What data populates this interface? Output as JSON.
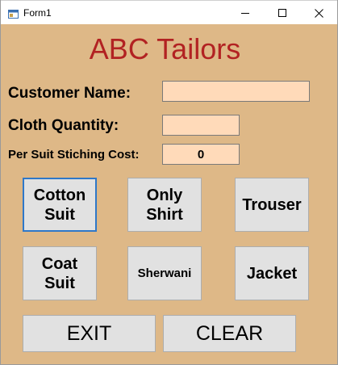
{
  "window": {
    "title": "Form1",
    "icon": "form-icon",
    "controls": {
      "minimize_icon": "minimize-icon",
      "maximize_icon": "maximize-icon",
      "close_icon": "close-icon"
    }
  },
  "form": {
    "heading": "ABC Tailors",
    "customer_name": {
      "label": "Customer Name:",
      "value": ""
    },
    "cloth_quantity": {
      "label": "Cloth Quantity:",
      "value": ""
    },
    "per_suit_cost": {
      "label": "Per Suit Stiching Cost:",
      "value": "0"
    }
  },
  "buttons": {
    "cotton_suit": {
      "line1": "Cotton",
      "line2": "Suit"
    },
    "only_shirt": {
      "line1": "Only",
      "line2": "Shirt"
    },
    "trouser": "Trouser",
    "coat_suit": {
      "line1": "Coat",
      "line2": "Suit"
    },
    "sherwani": "Sherwani",
    "jacket": "Jacket",
    "exit": "EXIT",
    "clear": "CLEAR"
  },
  "colors": {
    "form_background": "#deb887",
    "heading": "#b22222",
    "input_background": "#ffdab9",
    "button_background": "#e1e1e1",
    "focus_border": "#2f78c8"
  }
}
